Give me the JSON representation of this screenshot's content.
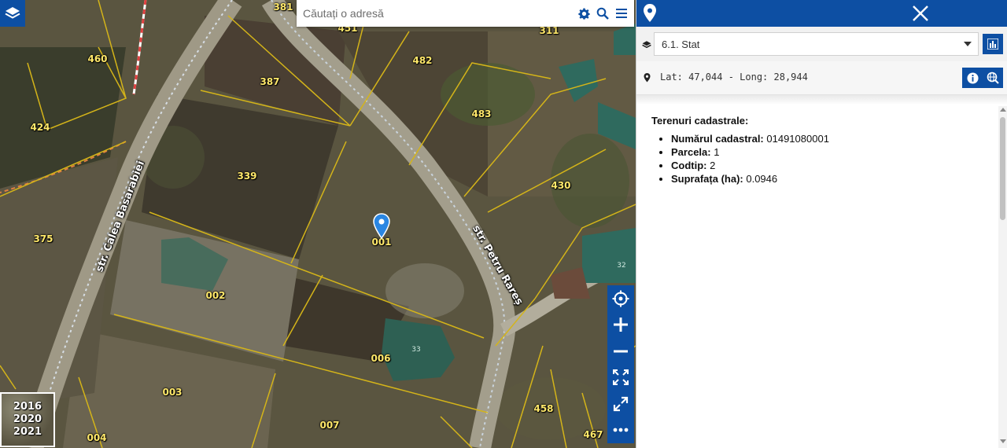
{
  "search": {
    "placeholder": "Căutați o adresă"
  },
  "years": [
    "2016",
    "2020",
    "2021"
  ],
  "map": {
    "streets": [
      "str. Calea Basarabiei",
      "str. Petru Rareș"
    ],
    "parcels": [
      "381",
      "451",
      "311",
      "460",
      "482",
      "387",
      "424",
      "483",
      "339",
      "430",
      "375",
      "001",
      "32",
      "002",
      "33",
      "006",
      "003",
      "458",
      "007",
      "004",
      "467"
    ],
    "house_numbers": [
      "32",
      "33"
    ]
  },
  "panel": {
    "layer_selected": "6.1. Stat",
    "coordinates": "Lat: 47,044 - Long: 28,944",
    "info_title": "Terenuri cadastrale:",
    "fields": [
      {
        "label": "Numărul cadastral:",
        "value": "01491080001"
      },
      {
        "label": "Parcela:",
        "value": "1"
      },
      {
        "label": "Codtip:",
        "value": "2"
      },
      {
        "label": "Suprafața (ha):",
        "value": "0.0946"
      }
    ]
  },
  "colors": {
    "brand": "#0d4fa3",
    "parcel_line": "#d4b419",
    "parcel_label": "#ffe86a"
  }
}
